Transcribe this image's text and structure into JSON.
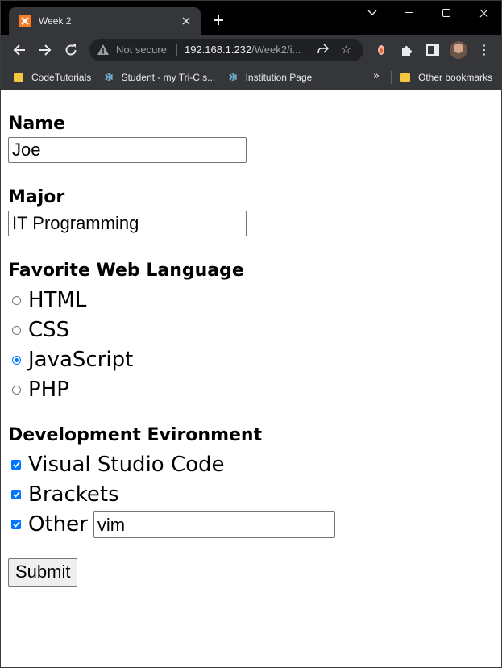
{
  "tab": {
    "title": "Week 2",
    "favicon_letter": "XX"
  },
  "toolbar": {
    "security_label": "Not secure",
    "url_host": "192.168.1.232",
    "url_path": "/Week2/i..."
  },
  "bookmarks": {
    "items": [
      "CodeTutorials",
      "Student - my Tri-C s...",
      "Institution Page"
    ],
    "other": "Other bookmarks",
    "overflow": "»"
  },
  "form": {
    "name_label": "Name",
    "name_value": "Joe",
    "major_label": "Major",
    "major_value": "IT Programming",
    "language_label": "Favorite Web Language",
    "languages": [
      {
        "label": "HTML",
        "selected": false
      },
      {
        "label": "CSS",
        "selected": false
      },
      {
        "label": "JavaScript",
        "selected": true
      },
      {
        "label": "PHP",
        "selected": false
      }
    ],
    "environment_label": "Development Evironment",
    "environments": [
      {
        "label": "Visual Studio Code",
        "checked": true
      },
      {
        "label": "Brackets",
        "checked": true
      },
      {
        "label": "Other",
        "checked": true
      }
    ],
    "other_value": "vim",
    "submit_label": "Submit"
  },
  "colors": {
    "accent": "#0075ff",
    "chrome_dark": "#35363a",
    "titlebar": "#000000"
  }
}
